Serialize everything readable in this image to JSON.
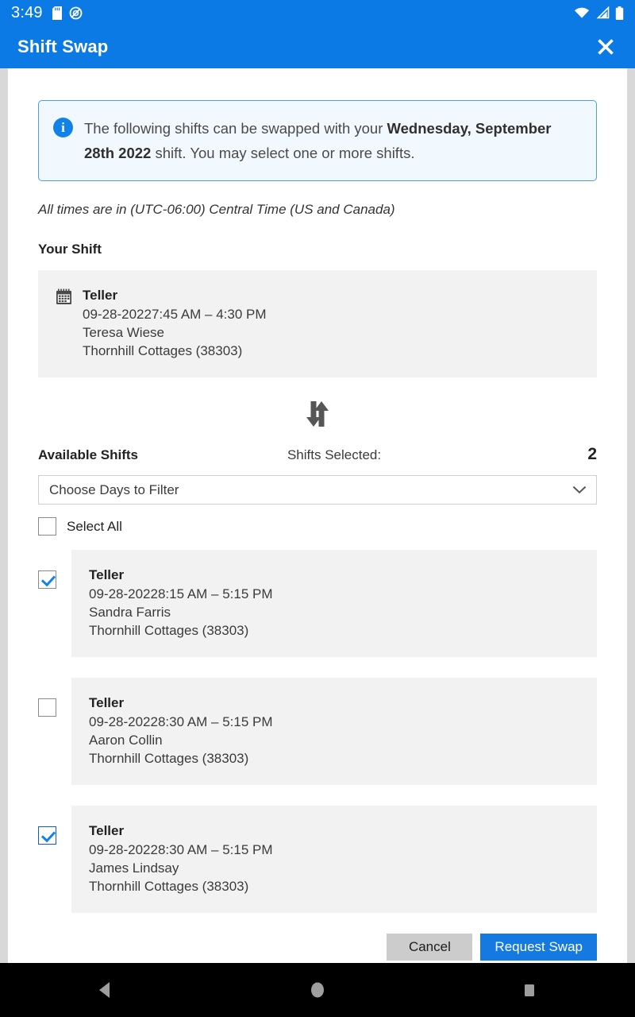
{
  "status_bar": {
    "clock": "3:49",
    "left_icons": [
      "sd-card-icon",
      "do-not-disturb-icon"
    ],
    "right_icons": [
      "wifi-icon",
      "cellular-signal-icon",
      "battery-icon"
    ]
  },
  "app_bar": {
    "title": "Shift Swap",
    "close_icon": "close-icon"
  },
  "info_banner": {
    "icon": "info-icon",
    "text_before": "The following shifts can be swapped with your ",
    "text_bold": "Wednesday, September 28th 2022",
    "text_after": " shift. You may select one or more shifts.",
    "border_color": "#4a9fe0",
    "background_color": "#f2f9fe"
  },
  "timezone_note": "All times are in (UTC-06:00) Central Time (US and Canada)",
  "your_shift": {
    "heading": "Your Shift",
    "icon": "calendar-icon",
    "role": "Teller",
    "datetime": "09-28-20227:45 AM – 4:30 PM",
    "person": "Teresa Wiese",
    "location": "Thornhill Cottages (38303)"
  },
  "swap_icon": "swap-vertical-arrows-icon",
  "available": {
    "heading": "Available Shifts",
    "selected_label": "Shifts Selected:",
    "selected_count": "2",
    "filter_placeholder": "Choose Days to Filter",
    "filter_chevron": "chevron-down-icon",
    "select_all_label": "Select All",
    "select_all_checked": false,
    "shifts": [
      {
        "checked": true,
        "focused": false,
        "role": "Teller",
        "datetime": "09-28-20228:15 AM – 5:15 PM",
        "person": "Sandra Farris",
        "location": "Thornhill Cottages (38303)"
      },
      {
        "checked": false,
        "focused": false,
        "role": "Teller",
        "datetime": "09-28-20228:30 AM – 5:15 PM",
        "person": "Aaron Collin",
        "location": "Thornhill Cottages (38303)"
      },
      {
        "checked": true,
        "focused": true,
        "role": "Teller",
        "datetime": "09-28-20228:30 AM – 5:15 PM",
        "person": "James Lindsay",
        "location": "Thornhill Cottages (38303)"
      }
    ]
  },
  "footer": {
    "cancel_label": "Cancel",
    "submit_label": "Request Swap",
    "cancel_color": "#cccccc",
    "submit_color": "#1479e0"
  },
  "nav_bar": {
    "back_icon": "back-triangle-icon",
    "home_icon": "home-circle-icon",
    "recents_icon": "recents-square-icon"
  },
  "theme": {
    "accent": "#0b7ae5",
    "card_background": "#f2f2f2"
  }
}
